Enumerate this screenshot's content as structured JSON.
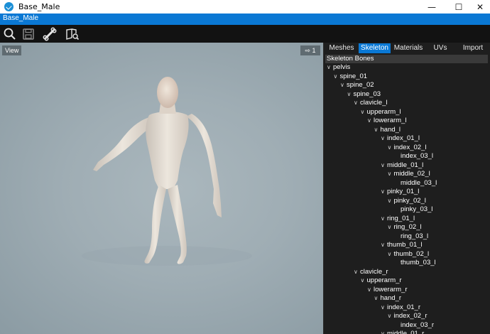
{
  "window": {
    "title": "Base_Male",
    "minimize": "—",
    "maximize": "☐",
    "close": "✕"
  },
  "doc_tab": {
    "label": "Base_Male"
  },
  "toolbar": {
    "icons": [
      "search-icon",
      "save-icon",
      "bone-icon",
      "book-search-icon"
    ]
  },
  "viewport": {
    "view_label": "View",
    "camera_label": "⇨ 1"
  },
  "panel": {
    "tabs": [
      "Meshes",
      "Skeleton",
      "Materials",
      "UVs",
      "Import"
    ],
    "active_tab": "Skeleton",
    "tree_header": "Skeleton Bones",
    "bones": [
      {
        "label": "pelvis",
        "depth": 0,
        "expandable": true
      },
      {
        "label": "spine_01",
        "depth": 1,
        "expandable": true
      },
      {
        "label": "spine_02",
        "depth": 2,
        "expandable": true
      },
      {
        "label": "spine_03",
        "depth": 3,
        "expandable": true
      },
      {
        "label": "clavicle_l",
        "depth": 4,
        "expandable": true
      },
      {
        "label": "upperarm_l",
        "depth": 5,
        "expandable": true
      },
      {
        "label": "lowerarm_l",
        "depth": 6,
        "expandable": true
      },
      {
        "label": "hand_l",
        "depth": 7,
        "expandable": true
      },
      {
        "label": "index_01_l",
        "depth": 8,
        "expandable": true
      },
      {
        "label": "index_02_l",
        "depth": 9,
        "expandable": true
      },
      {
        "label": "index_03_l",
        "depth": 10,
        "expandable": false
      },
      {
        "label": "middle_01_l",
        "depth": 8,
        "expandable": true
      },
      {
        "label": "middle_02_l",
        "depth": 9,
        "expandable": true
      },
      {
        "label": "middle_03_l",
        "depth": 10,
        "expandable": false
      },
      {
        "label": "pinky_01_l",
        "depth": 8,
        "expandable": true
      },
      {
        "label": "pinky_02_l",
        "depth": 9,
        "expandable": true
      },
      {
        "label": "pinky_03_l",
        "depth": 10,
        "expandable": false
      },
      {
        "label": "ring_01_l",
        "depth": 8,
        "expandable": true
      },
      {
        "label": "ring_02_l",
        "depth": 9,
        "expandable": true
      },
      {
        "label": "ring_03_l",
        "depth": 10,
        "expandable": false
      },
      {
        "label": "thumb_01_l",
        "depth": 8,
        "expandable": true
      },
      {
        "label": "thumb_02_l",
        "depth": 9,
        "expandable": true
      },
      {
        "label": "thumb_03_l",
        "depth": 10,
        "expandable": false
      },
      {
        "label": "clavicle_r",
        "depth": 4,
        "expandable": true
      },
      {
        "label": "upperarm_r",
        "depth": 5,
        "expandable": true
      },
      {
        "label": "lowerarm_r",
        "depth": 6,
        "expandable": true
      },
      {
        "label": "hand_r",
        "depth": 7,
        "expandable": true
      },
      {
        "label": "index_01_r",
        "depth": 8,
        "expandable": true
      },
      {
        "label": "index_02_r",
        "depth": 9,
        "expandable": true
      },
      {
        "label": "index_03_r",
        "depth": 10,
        "expandable": false
      },
      {
        "label": "middle_01_r",
        "depth": 8,
        "expandable": true
      }
    ]
  },
  "colors": {
    "accent": "#0a78d4",
    "panel_bg": "#1e1e1e",
    "viewport_bg": "#9fadb4"
  }
}
